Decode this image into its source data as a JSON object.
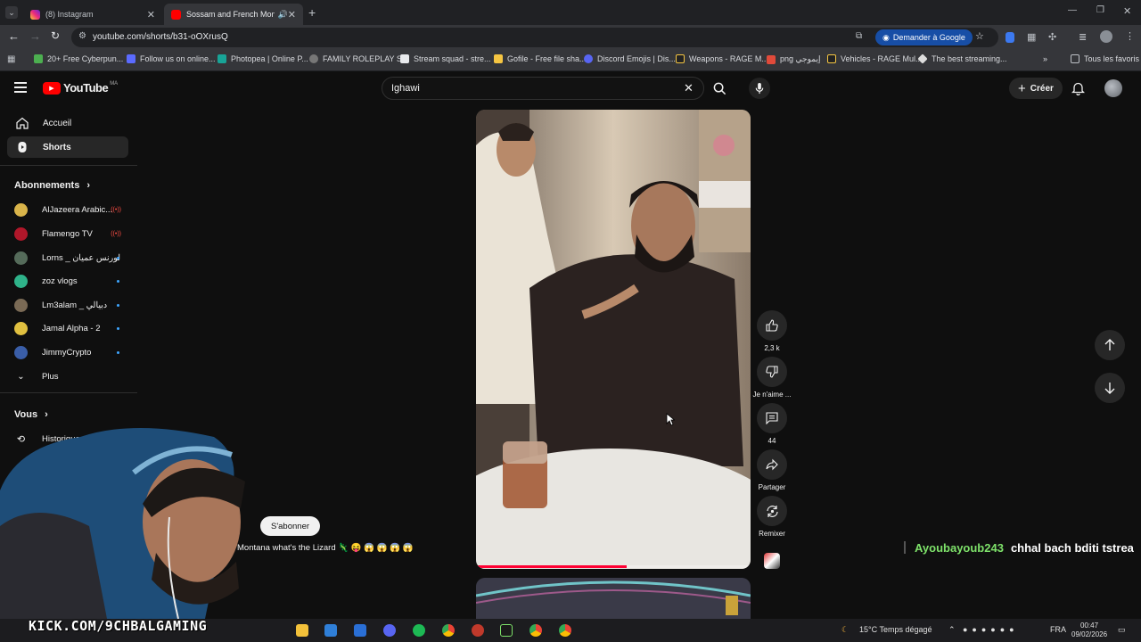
{
  "browser": {
    "tabs": [
      {
        "title": "(8) Instagram",
        "active": false
      },
      {
        "title": "Sossam and French Monta",
        "active": true
      }
    ],
    "url": "youtube.com/shorts/b31-oOXrusQ",
    "ask_google": "Demander à Google",
    "bookmarks": [
      "20+ Free Cyberpun...",
      "Follow us on online...",
      "Photopea | Online P...",
      "FAMILY ROLEPLAY S...",
      "Stream squad - stre...",
      "Gofile - Free file sha...",
      "Discord Emojis | Dis...",
      "Weapons - RAGE M...",
      "png إيموجي",
      "Vehicles - RAGE Mul...",
      "The best streaming..."
    ],
    "all_favorites": "Tous les favoris"
  },
  "youtube": {
    "logo": "YouTube",
    "region": "MA",
    "search_value": "Ighawi",
    "create_label": "Créer",
    "nav": [
      {
        "label": "Accueil",
        "icon": "home-icon"
      },
      {
        "label": "Shorts",
        "icon": "shorts-icon"
      }
    ],
    "subscriptions_heading": "Abonnements",
    "subscriptions": [
      {
        "name": "AlJazeera Arabic...",
        "color": "#d9b44a",
        "live": true
      },
      {
        "name": "Flamengo TV",
        "color": "#b0172a",
        "live": true
      },
      {
        "name": "Lorns _ لورنس عميان",
        "color": "#556b5a",
        "live": false
      },
      {
        "name": "zoz vlogs",
        "color": "#2fb38a",
        "live": false
      },
      {
        "name": "Lm3alam _ دبيالي",
        "color": "#7a6a55",
        "live": false
      },
      {
        "name": "Jamal Alpha - 2",
        "color": "#e0c040",
        "live": false
      },
      {
        "name": "JimmyCrypto",
        "color": "#3a5ea8",
        "live": false
      }
    ],
    "more_label": "Plus",
    "you_heading": "Vous",
    "history_label": "Historique",
    "subscribe_label": "S'abonner",
    "video_title": "Montana what's the Lizard 🦎 😝 😱 😱 😱 😱",
    "actions": {
      "likes": "2,3 k",
      "dislike": "Je n'aime ...",
      "comments": "44",
      "share": "Partager",
      "remix": "Remixer"
    },
    "progress": 0.55
  },
  "overlay": {
    "chat_user": "Ayoubayoub243",
    "chat_message": "chhal bach bditi tstrea",
    "watermark": "KICK.COM/9CHBALGAMING"
  },
  "taskbar": {
    "weather": "15°C  Temps dégagé",
    "lang": "FRA",
    "time": "00:47",
    "date": "09/02/2026"
  }
}
